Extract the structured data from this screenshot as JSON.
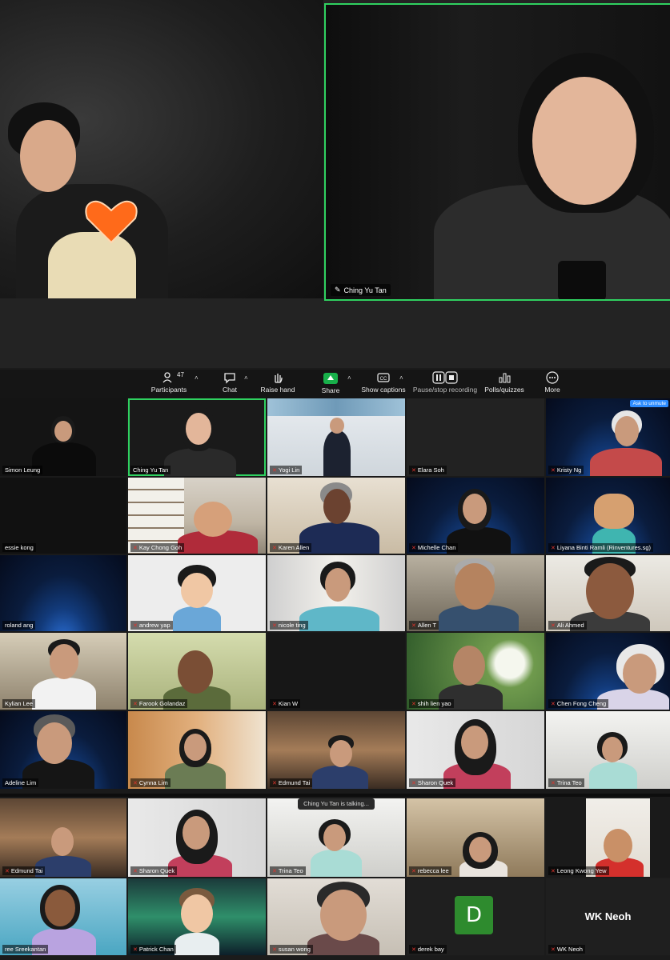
{
  "speaker": {
    "active_speaker_name": "Ching Yu Tan"
  },
  "toolbar": {
    "participants_label": "Participants",
    "participants_count": "47",
    "chat_label": "Chat",
    "raise_hand_label": "Raise hand",
    "share_label": "Share",
    "captions_label": "Show captions",
    "record_label": "Pause/stop recording",
    "polls_label": "Polls/quizzes",
    "more_label": "More",
    "accent_color": "#18b04a"
  },
  "gallery": {
    "ask_to_unmute": "Ask to unmute",
    "tiles": [
      {
        "name": "Simon Leung"
      },
      {
        "name": "Ching Yu Tan"
      },
      {
        "name": "Yogi Lin"
      },
      {
        "name": "Elara Soh"
      },
      {
        "name": "Kristy Ng"
      },
      {
        "name": "essie kong"
      },
      {
        "name": "Kay Chong Goh"
      },
      {
        "name": "Karen Allen"
      },
      {
        "name": "Michelle Chan"
      },
      {
        "name": "Liyana Binti Ramli (Rinventures.sg)"
      },
      {
        "name": "roland ang"
      },
      {
        "name": "andrew yap"
      },
      {
        "name": "nicole ting"
      },
      {
        "name": "Allen T"
      },
      {
        "name": "Ali Ahmed"
      },
      {
        "name": "Kylian Lee"
      },
      {
        "name": "Farook Golandaz"
      },
      {
        "name": "Kian W"
      },
      {
        "name": "shih lien yao"
      },
      {
        "name": "Chen Fong Cheng"
      },
      {
        "name": "Adeline Lim"
      },
      {
        "name": "Cynna Lim"
      },
      {
        "name": "Edmund Tai"
      },
      {
        "name": "Sharon Quek"
      },
      {
        "name": "Trina Teo"
      }
    ]
  },
  "bottom": {
    "talking_text": "Ching Yu Tan is talking...",
    "tiles": [
      {
        "name": "Edmund Tai"
      },
      {
        "name": "Sharon Quek"
      },
      {
        "name": "Trina Teo"
      },
      {
        "name": "rebecca lee"
      },
      {
        "name": "Leong Kwong Yew"
      },
      {
        "name": "ree Sreekantan"
      },
      {
        "name": "Patrick Chan"
      },
      {
        "name": "susan wong"
      },
      {
        "name": "derek bay",
        "avatar_letter": "D"
      },
      {
        "name": "WK Neoh",
        "display_name": "WK Neoh"
      }
    ]
  }
}
